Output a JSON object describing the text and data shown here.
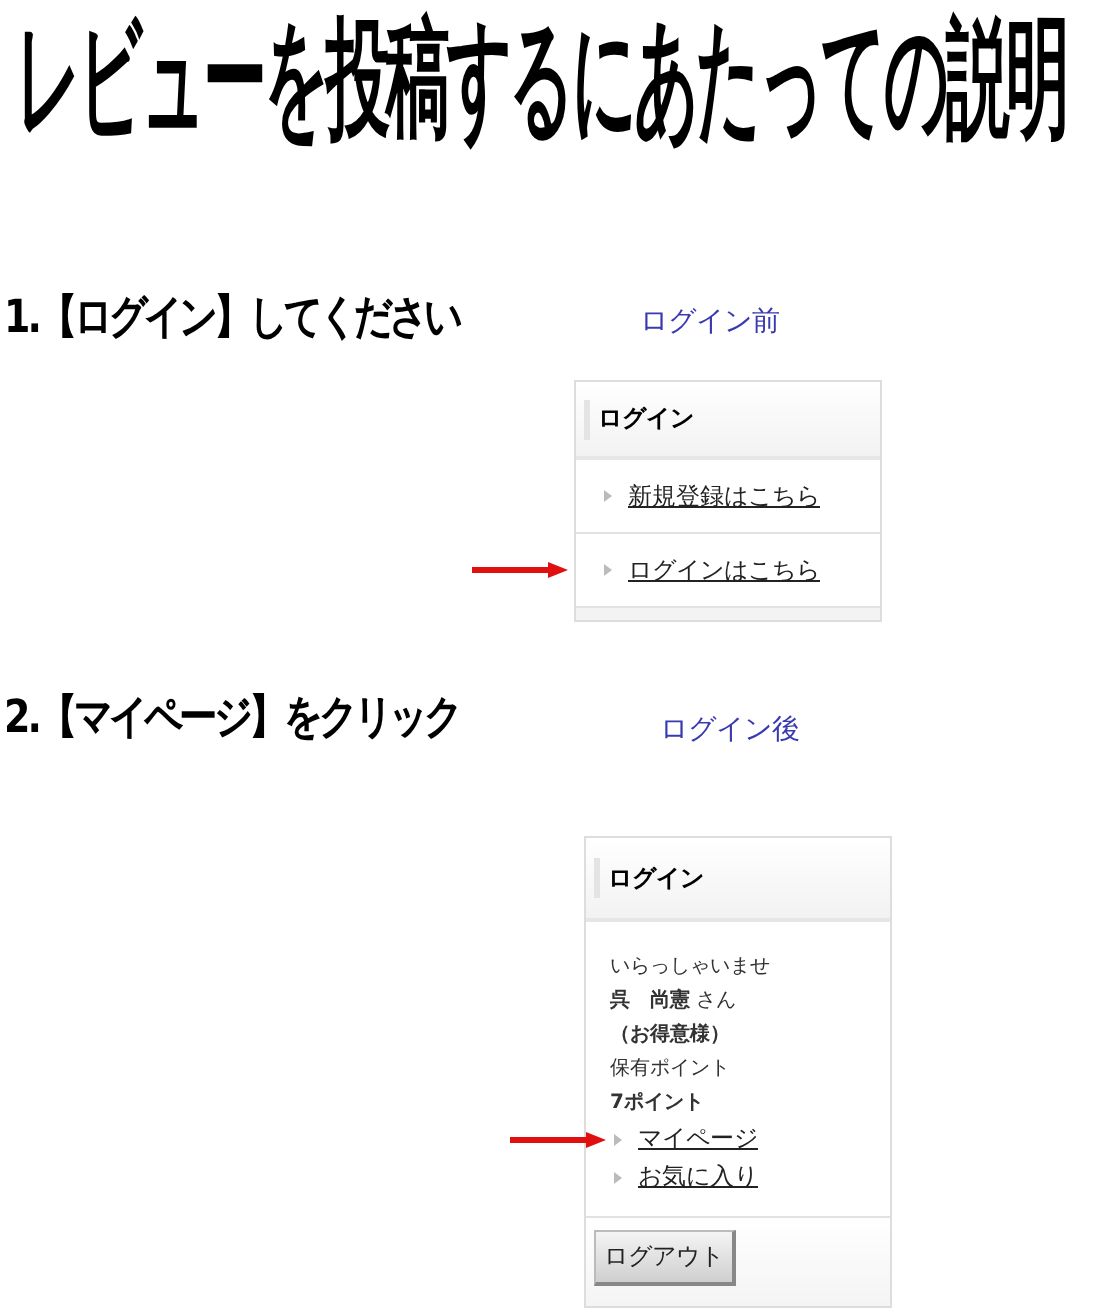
{
  "title": "レビューを投稿するにあたっての説明",
  "steps": [
    {
      "heading": "1.【ログイン】してください",
      "caption": "ログイン前",
      "widget": {
        "kind": "guest",
        "header": "ログイン",
        "links": [
          {
            "label": "新規登録はこちら",
            "pointed": false
          },
          {
            "label": "ログインはこちら",
            "pointed": true
          }
        ]
      }
    },
    {
      "heading": "2.【マイページ】をクリック",
      "caption": "ログイン後",
      "widget": {
        "kind": "member",
        "header": "ログイン",
        "lines": [
          {
            "text": "いらっしゃいませ",
            "bold": false
          },
          {
            "text": "**呉　尚憲** さん",
            "bold": false
          },
          {
            "text": "（お得意様）",
            "bold": true
          },
          {
            "text": "保有ポイント",
            "bold": false
          },
          {
            "text": "7ポイント",
            "bold": true
          }
        ],
        "links": [
          {
            "label": "マイページ",
            "pointed": true
          },
          {
            "label": "お気に入り",
            "pointed": false
          }
        ],
        "button": "ログアウト"
      }
    }
  ]
}
